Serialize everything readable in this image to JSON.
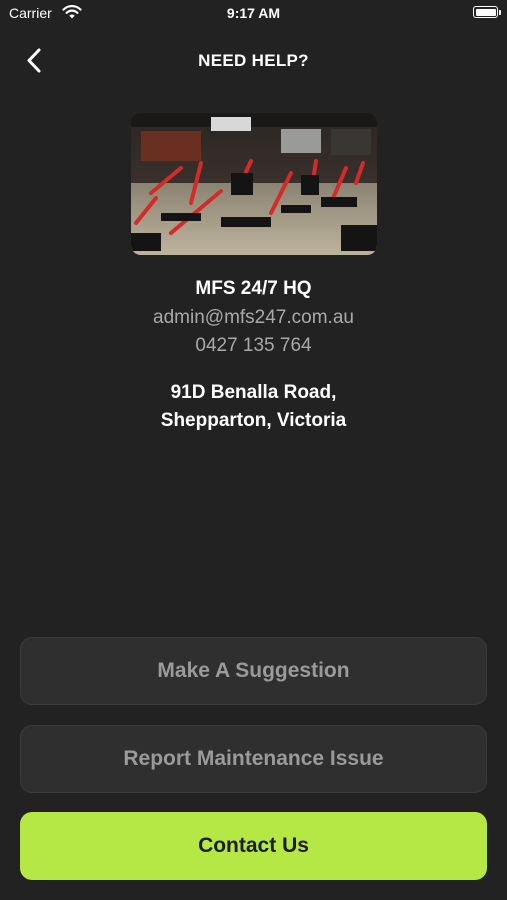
{
  "status_bar": {
    "carrier": "Carrier",
    "time": "9:17 AM",
    "wifi_icon": "wifi-icon",
    "battery_icon": "battery-icon"
  },
  "header": {
    "title": "NEED HELP?",
    "back_icon": "chevron-left-icon"
  },
  "location": {
    "name": "MFS 24/7 HQ",
    "email": "admin@mfs247.com.au",
    "phone": "0427 135 764",
    "address_line1": "91D Benalla Road,",
    "address_line2": "Shepparton, Victoria"
  },
  "actions": {
    "suggestion_label": "Make A Suggestion",
    "maintenance_label": "Report Maintenance Issue",
    "contact_label": "Contact Us"
  },
  "colors": {
    "background": "#222222",
    "button_dark": "#2f2f2f",
    "accent": "#b5e845"
  }
}
